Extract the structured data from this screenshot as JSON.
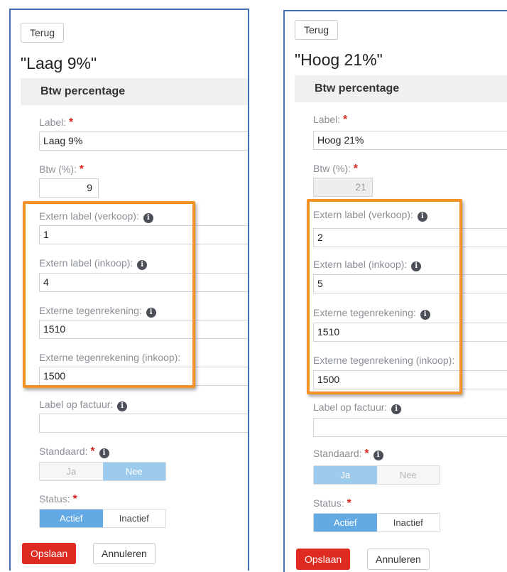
{
  "colors": {
    "highlight": "#f29227",
    "panel_border": "#3f6fb0",
    "primary_blue": "#63a9e4",
    "danger_red": "#de2a21"
  },
  "panels": [
    {
      "back_label": "Terug",
      "title": "\"Laag 9%\"",
      "section_title": "Btw percentage",
      "label_label": "Label:",
      "label_value": "Laag 9%",
      "btw_label": "Btw (%):",
      "btw_value": "9",
      "ext_sale_label": "Extern label (verkoop):",
      "ext_sale_value": "1",
      "ext_purchase_label": "Extern label (inkoop):",
      "ext_purchase_value": "4",
      "ext_counter_label": "Externe tegenrekening:",
      "ext_counter_value": "1510",
      "ext_counter_purchase_label": "Externe tegenrekening (inkoop):",
      "ext_counter_purchase_value": "1500",
      "invoice_label": "Label op factuur:",
      "invoice_value": "",
      "standard_label": "Standaard:",
      "standard_yes": "Ja",
      "standard_no": "Nee",
      "standard_selected": "Nee",
      "status_label": "Status:",
      "status_active": "Actief",
      "status_inactive": "Inactief",
      "status_selected": "Actief",
      "save_label": "Opslaan",
      "cancel_label": "Annuleren"
    },
    {
      "back_label": "Terug",
      "title": "\"Hoog 21%\"",
      "section_title": "Btw percentage",
      "label_label": "Label:",
      "label_value": "Hoog 21%",
      "btw_label": "Btw (%):",
      "btw_value": "21",
      "ext_sale_label": "Extern label (verkoop):",
      "ext_sale_value": "2",
      "ext_purchase_label": "Extern label (inkoop):",
      "ext_purchase_value": "5",
      "ext_counter_label": "Externe tegenrekening:",
      "ext_counter_value": "1510",
      "ext_counter_purchase_label": "Externe tegenrekening (inkoop):",
      "ext_counter_purchase_value": "1500",
      "invoice_label": "Label op factuur:",
      "invoice_value": "",
      "standard_label": "Standaard:",
      "standard_yes": "Ja",
      "standard_no": "Nee",
      "standard_selected": "Ja",
      "status_label": "Status:",
      "status_active": "Actief",
      "status_inactive": "Inactief",
      "status_selected": "Actief",
      "save_label": "Opslaan",
      "cancel_label": "Annuleren"
    }
  ],
  "icons": {
    "info": "info-circle-icon",
    "required": "asterisk"
  },
  "info_glyph": "i",
  "required_mark": "*"
}
